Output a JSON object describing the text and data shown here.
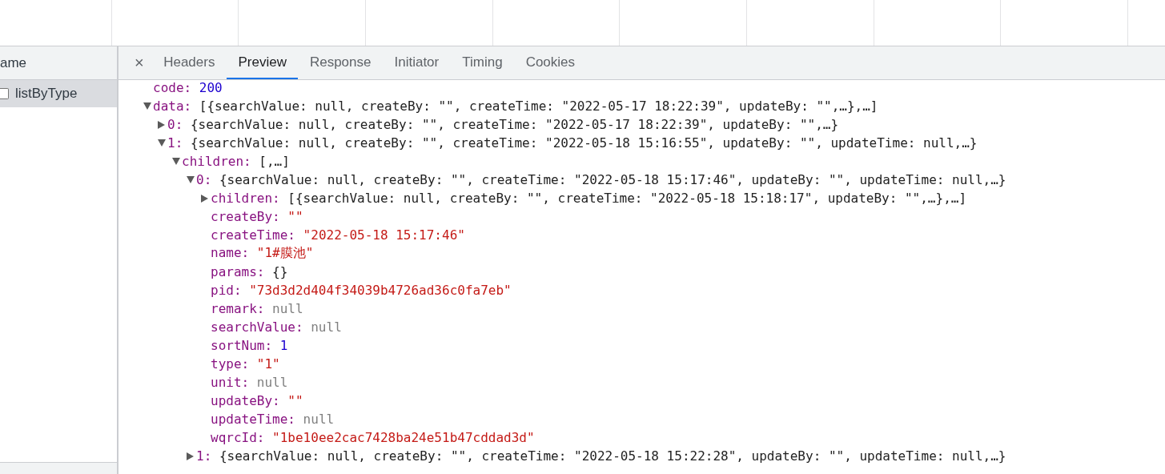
{
  "name_column": {
    "header": "ame",
    "requests": [
      {
        "name": "listByType",
        "selected": true,
        "checked": false
      }
    ]
  },
  "tabs": [
    {
      "label": "Headers",
      "selected": false
    },
    {
      "label": "Preview",
      "selected": true
    },
    {
      "label": "Response",
      "selected": false
    },
    {
      "label": "Initiator",
      "selected": false
    },
    {
      "label": "Timing",
      "selected": false
    },
    {
      "label": "Cookies",
      "selected": false
    }
  ],
  "close_button": "×",
  "tree": [
    {
      "key": "code:",
      "value": "200",
      "kind": "number"
    },
    {
      "key": "data:",
      "value": "[{searchValue: null, createBy: \"\", createTime: \"2022-05-17 18:22:39\", updateBy: \"\",…},…]",
      "expanded": true,
      "children": [
        {
          "key": "0:",
          "value": "{searchValue: null, createBy: \"\", createTime: \"2022-05-17 18:22:39\", updateBy: \"\",…}",
          "expanded": false
        },
        {
          "key": "1:",
          "value": "{searchValue: null, createBy: \"\", createTime: \"2022-05-18 15:16:55\", updateBy: \"\", updateTime: null,…}",
          "expanded": true,
          "children": [
            {
              "key": "children:",
              "value": "[,…]",
              "expanded": true,
              "children": [
                {
                  "key": "0:",
                  "value": "{searchValue: null, createBy: \"\", createTime: \"2022-05-18 15:17:46\", updateBy: \"\", updateTime: null,…}",
                  "expanded": true,
                  "children": [
                    {
                      "key": "children:",
                      "value": "[{searchValue: null, createBy: \"\", createTime: \"2022-05-18 15:18:17\", updateBy: \"\",…},…]",
                      "expanded": false
                    },
                    {
                      "key": "createBy:",
                      "value": "\"\"",
                      "kind": "string"
                    },
                    {
                      "key": "createTime:",
                      "value": "\"2022-05-18 15:17:46\"",
                      "kind": "string"
                    },
                    {
                      "key": "name:",
                      "value": "\"1#膜池\"",
                      "kind": "string"
                    },
                    {
                      "key": "params:",
                      "value": "{}"
                    },
                    {
                      "key": "pid:",
                      "value": "\"73d3d2d404f34039b4726ad36c0fa7eb\"",
                      "kind": "string"
                    },
                    {
                      "key": "remark:",
                      "value": "null",
                      "kind": "null"
                    },
                    {
                      "key": "searchValue:",
                      "value": "null",
                      "kind": "null"
                    },
                    {
                      "key": "sortNum:",
                      "value": "1",
                      "kind": "number"
                    },
                    {
                      "key": "type:",
                      "value": "\"1\"",
                      "kind": "string"
                    },
                    {
                      "key": "unit:",
                      "value": "null",
                      "kind": "null"
                    },
                    {
                      "key": "updateBy:",
                      "value": "\"\"",
                      "kind": "string"
                    },
                    {
                      "key": "updateTime:",
                      "value": "null",
                      "kind": "null"
                    },
                    {
                      "key": "wqrcId:",
                      "value": "\"1be10ee2cac7428ba24e51b47cddad3d\"",
                      "kind": "string"
                    }
                  ]
                },
                {
                  "key": "1:",
                  "value": "{searchValue: null, createBy: \"\", createTime: \"2022-05-18 15:22:28\", updateBy: \"\", updateTime: null,…}",
                  "expanded": false
                }
              ]
            }
          ]
        }
      ]
    }
  ]
}
